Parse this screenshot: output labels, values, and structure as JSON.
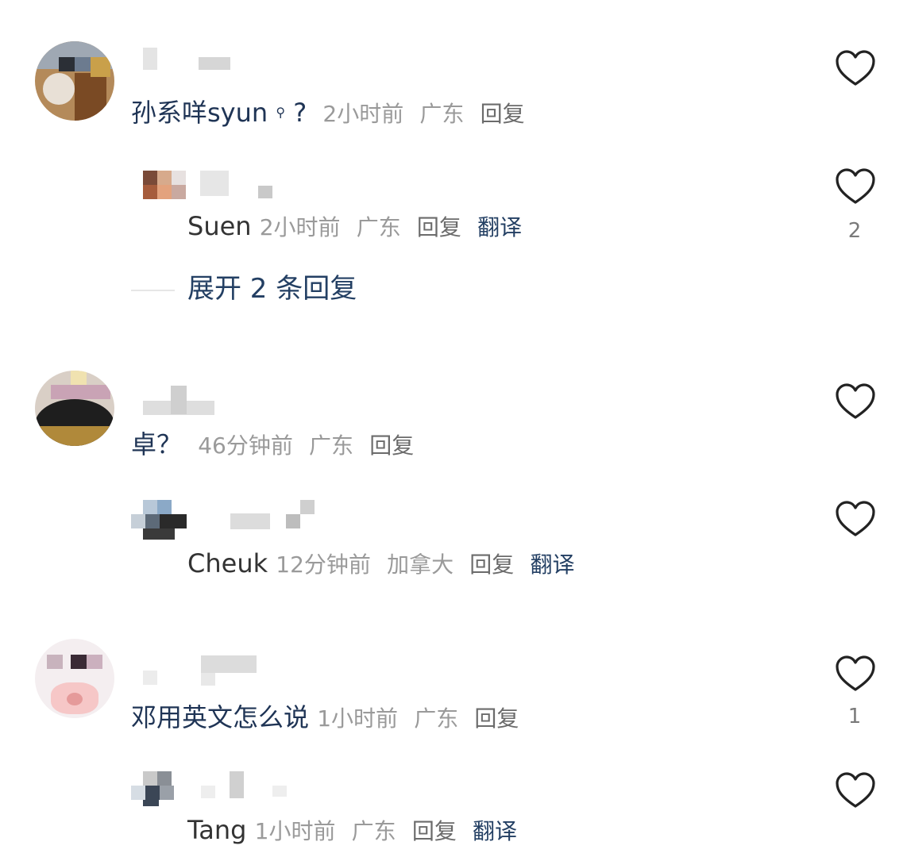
{
  "comments": [
    {
      "text": "孙系咩syun",
      "extra": "?",
      "time": "2小时前",
      "location": "广东",
      "reply_label": "回复",
      "like_count": "",
      "replies": [
        {
          "text": "Suen",
          "time": "2小时前",
          "location": "广东",
          "reply_label": "回复",
          "translate_label": "翻译",
          "like_count": "2"
        }
      ],
      "expand_label": "展开 2 条回复"
    },
    {
      "text": "卓？",
      "time": "46分钟前",
      "location": "广东",
      "reply_label": "回复",
      "like_count": "",
      "replies": [
        {
          "text": "Cheuk",
          "time": "12分钟前",
          "location": "加拿大",
          "reply_label": "回复",
          "translate_label": "翻译",
          "like_count": ""
        }
      ]
    },
    {
      "text": "邓用英文怎么说",
      "time": "1小时前",
      "location": "广东",
      "reply_label": "回复",
      "like_count": "1",
      "replies": [
        {
          "text": "Tang",
          "time": "1小时前",
          "location": "广东",
          "reply_label": "回复",
          "translate_label": "翻译",
          "like_count": ""
        }
      ]
    }
  ],
  "icons": {
    "like": "heart-outline-icon",
    "search": "search-icon"
  },
  "colors": {
    "link": "#233f63",
    "meta": "#9a9a9a",
    "heart": "#222222"
  }
}
